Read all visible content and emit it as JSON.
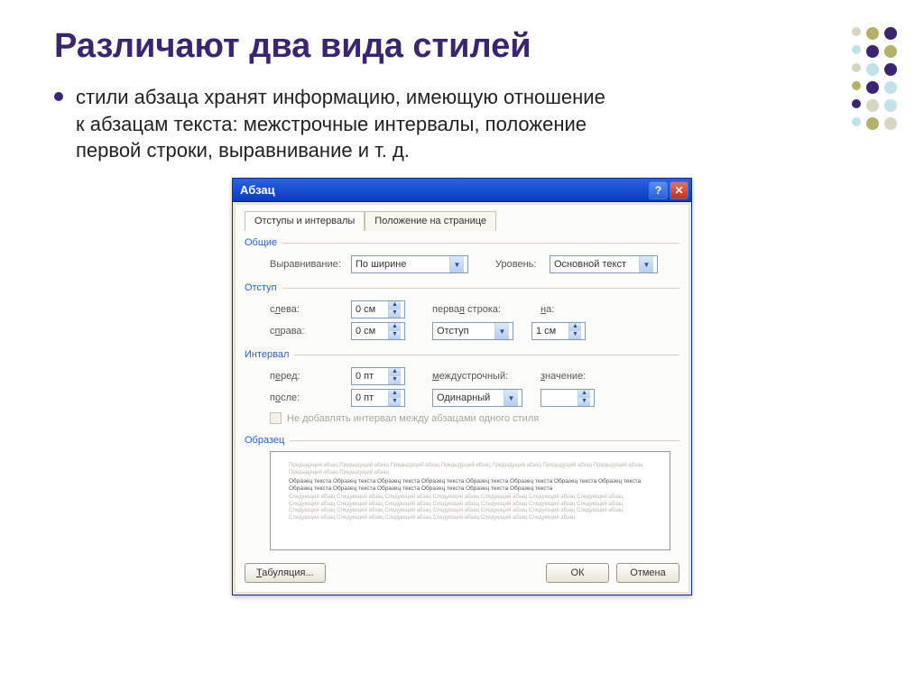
{
  "slide": {
    "title": "Различают два вида стилей",
    "bullet": "стили абзаца хранят информацию, имеющую отношение к абзацам текста: межстрочные интервалы, положение первой строки, выравнивание и т. д."
  },
  "dialog": {
    "title": "Абзац",
    "tabs": {
      "active": "Отступы и интервалы",
      "other": "Положение на странице"
    },
    "groups": {
      "general": "Общие",
      "indent": "Отступ",
      "spacing": "Интервал",
      "preview": "Образец"
    },
    "general": {
      "align_label": "Выравнивание:",
      "align_value": "По ширине",
      "level_label": "Уровень:",
      "level_value": "Основной текст"
    },
    "indent": {
      "left_label": "слева:",
      "left_value": "0 см",
      "right_label": "справа:",
      "right_value": "0 см",
      "first_label": "первая строка:",
      "first_value": "Отступ",
      "by_label": "на:",
      "by_value": "1 см"
    },
    "spacing": {
      "before_label": "перед:",
      "before_value": "0 пт",
      "after_label": "после:",
      "after_value": "0 пт",
      "line_label": "междустрочный:",
      "line_value": "Одинарный",
      "at_label": "значение:",
      "at_value": "",
      "checkbox": "Не добавлять интервал между абзацами одного стиля"
    },
    "preview": {
      "light1": "Предыдущий абзац Предыдущий абзац Предыдущий абзац Предыдущий абзац Предыдущий абзац Предыдущий абзац Предыдущий абзац Предыдущий абзац Предыдущий абзац",
      "dark": "Образец текста Образец текста Образец текста Образец текста Образец текста Образец текста Образец текста Образец текста Образец текста Образец текста Образец текста Образец текста Образец текста Образец текста",
      "light2": "Следующий абзац Следующий абзац Следующий абзац Следующий абзац Следующий абзац Следующий абзац Следующий абзац Следующий абзац Следующий абзац Следующий абзац Следующий абзац Следующий абзац Следующий абзац Следующий абзац Следующий абзац Следующий абзац Следующий абзац Следующий абзац Следующий абзац Следующий абзац Следующий абзац Следующий абзац Следующий абзац Следующий абзац Следующий абзац Следующий абзац Следующий абзац"
    },
    "buttons": {
      "tabs": "Табуляция...",
      "ok": "ОК",
      "cancel": "Отмена"
    }
  }
}
